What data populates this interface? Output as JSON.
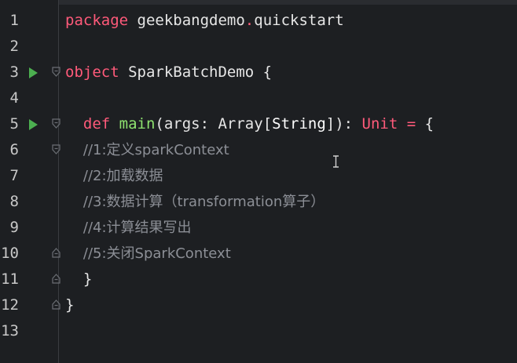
{
  "editor": {
    "lines": [
      {
        "num": "1",
        "tokens": [
          {
            "t": "package",
            "c": "kw"
          },
          {
            "t": " geekbangdemo",
            "c": "pl"
          },
          {
            "t": ".",
            "c": "kw"
          },
          {
            "t": "quickstart",
            "c": "pl"
          }
        ]
      },
      {
        "num": "2",
        "tokens": []
      },
      {
        "num": "3",
        "tokens": [
          {
            "t": "object",
            "c": "kw"
          },
          {
            "t": " SparkBatchDemo {",
            "c": "pl"
          }
        ]
      },
      {
        "num": "4",
        "tokens": []
      },
      {
        "num": "5",
        "tokens": [
          {
            "t": "  def",
            "c": "kw"
          },
          {
            "t": " ",
            "c": "pl"
          },
          {
            "t": "main",
            "c": "fn"
          },
          {
            "t": "(args: Array[",
            "c": "pl"
          },
          {
            "t": "String",
            "c": "ty"
          },
          {
            "t": "]): ",
            "c": "pl"
          },
          {
            "t": "Unit",
            "c": "kw"
          },
          {
            "t": " ",
            "c": "pl"
          },
          {
            "t": "=",
            "c": "kw"
          },
          {
            "t": " {",
            "c": "pl"
          }
        ]
      },
      {
        "num": "6",
        "tokens": [
          {
            "t": "    //1:定义sparkContext",
            "c": "comment"
          }
        ]
      },
      {
        "num": "7",
        "tokens": [
          {
            "t": "    //2:加载数据",
            "c": "comment"
          }
        ]
      },
      {
        "num": "8",
        "tokens": [
          {
            "t": "    //3:数据计算（transformation算子）",
            "c": "comment"
          }
        ]
      },
      {
        "num": "9",
        "tokens": [
          {
            "t": "    //4:计算结果写出",
            "c": "comment"
          }
        ]
      },
      {
        "num": "10",
        "tokens": [
          {
            "t": "    //5:关闭SparkContext",
            "c": "comment"
          }
        ]
      },
      {
        "num": "11",
        "tokens": [
          {
            "t": "  }",
            "c": "pl"
          }
        ]
      },
      {
        "num": "12",
        "tokens": [
          {
            "t": "}",
            "c": "pl"
          }
        ]
      },
      {
        "num": "13",
        "tokens": []
      }
    ],
    "run_marker_lines": [
      "3",
      "5"
    ],
    "fold_open_lines": [
      "3",
      "5",
      "6"
    ],
    "fold_close_lines": [
      "10",
      "11",
      "12"
    ],
    "colors": {
      "keyword": "#ff5a7a",
      "function": "#8ee26f",
      "plain": "#e6e6e6",
      "comment": "#8c8f96",
      "run_marker": "#4caf50",
      "background": "#1d1f22"
    }
  }
}
